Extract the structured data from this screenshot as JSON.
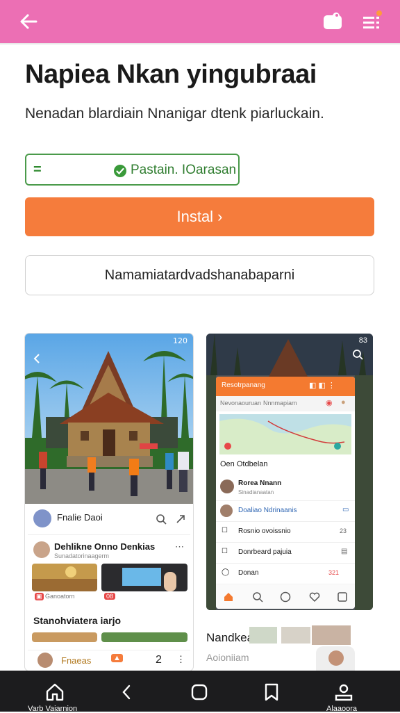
{
  "header": {
    "accent": "#ec6fb4",
    "back_icon": "arrow-left-icon",
    "right_icons": [
      "chat-bubble-icon",
      "menu-list-icon"
    ]
  },
  "page": {
    "title": "Napiea Nkan yingubraai",
    "subtitle": "Nenadan blardiain Nnanigar dtenk piarluckain."
  },
  "tag": {
    "left_symbol": "=",
    "label": "Pastain. IOarasan"
  },
  "install_button": {
    "label": "Instal ›",
    "color": "#f57c3c"
  },
  "secondary_button": {
    "label": "Namamiatardvadshanabaparni"
  },
  "screenshot1": {
    "status": "120",
    "header_name": "Fnalie Daoi",
    "post_title": "Dehlikne Onno Denkias",
    "post_sub": "Sunadatorinaagerm",
    "badge1": "Ganoatorn",
    "badge2": "08",
    "section_title": "Stanohviatera iarjo",
    "footer_name": "Fnaeas",
    "footer_num": "2"
  },
  "screenshot2": {
    "status": "83",
    "panel_title": "Resotrpanang",
    "search_a": "Nevonaouruan",
    "search_b": "Nnnmapiam",
    "section": "Oen Otdbelan",
    "rows": [
      {
        "label": "Rorea Nnann",
        "sub": "Sinadianaatan"
      },
      {
        "label": "Doaliao Ndrinaanis"
      },
      {
        "label": "Rosnio ovoissnio",
        "num": "23"
      },
      {
        "label": "Donrbeard pajuia"
      },
      {
        "label": "Donan",
        "num": "321"
      }
    ]
  },
  "below_shots": {
    "title": "Nandkea",
    "sub": "Aoioniiam"
  },
  "navbar": {
    "items": [
      {
        "icon": "home-icon",
        "label": "Varb Vaiarnion"
      },
      {
        "icon": "chevron-left-icon"
      },
      {
        "icon": "square-icon"
      },
      {
        "icon": "bookmark-icon"
      },
      {
        "icon": "profile-icon",
        "label": "Alaaoora"
      }
    ]
  }
}
